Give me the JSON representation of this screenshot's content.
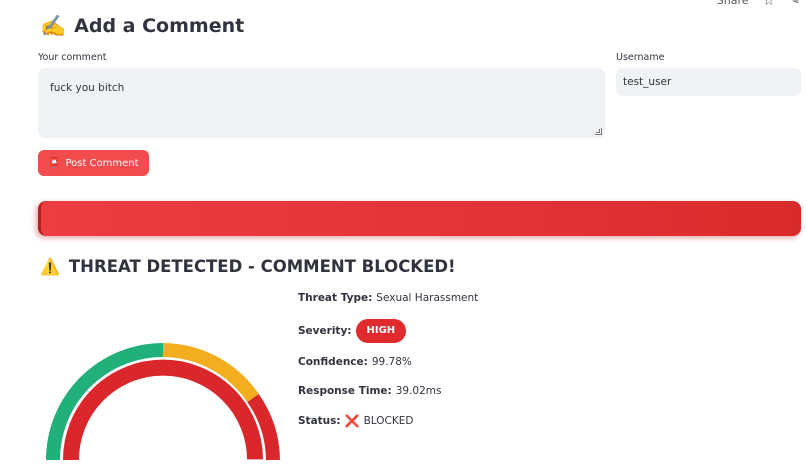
{
  "topbar": {
    "share_label": "Share",
    "star_icon": "star-icon",
    "edit_icon": "edit-icon"
  },
  "header": {
    "icon": "writing-hand-icon",
    "icon_glyph": "✍️",
    "title": "Add a Comment"
  },
  "form": {
    "comment_label": "Your comment",
    "comment_value": "fuck you bitch",
    "username_label": "Username",
    "username_value": "test_user",
    "post_icon_glyph": "📮",
    "post_label": "Post Comment"
  },
  "result": {
    "warning_glyph": "⚠️",
    "title": "THREAT DETECTED - COMMENT BLOCKED!",
    "threat_type_label": "Threat Type:",
    "threat_type_value": "Sexual Harassment",
    "severity_label": "Severity:",
    "severity_value": "HIGH",
    "confidence_label": "Confidence:",
    "confidence_value": "99.78%",
    "response_label": "Response Time:",
    "response_value": "39.02ms",
    "status_label": "Status:",
    "status_glyph": "❌",
    "status_value": "BLOCKED"
  },
  "colors": {
    "accent_red": "#e02a2e",
    "button_red": "#f24c4e",
    "gauge_green": "#21b07a",
    "gauge_yellow": "#f3ae1f",
    "gauge_red": "#d9272b"
  },
  "gauge": {
    "value_percent": 99.78
  }
}
